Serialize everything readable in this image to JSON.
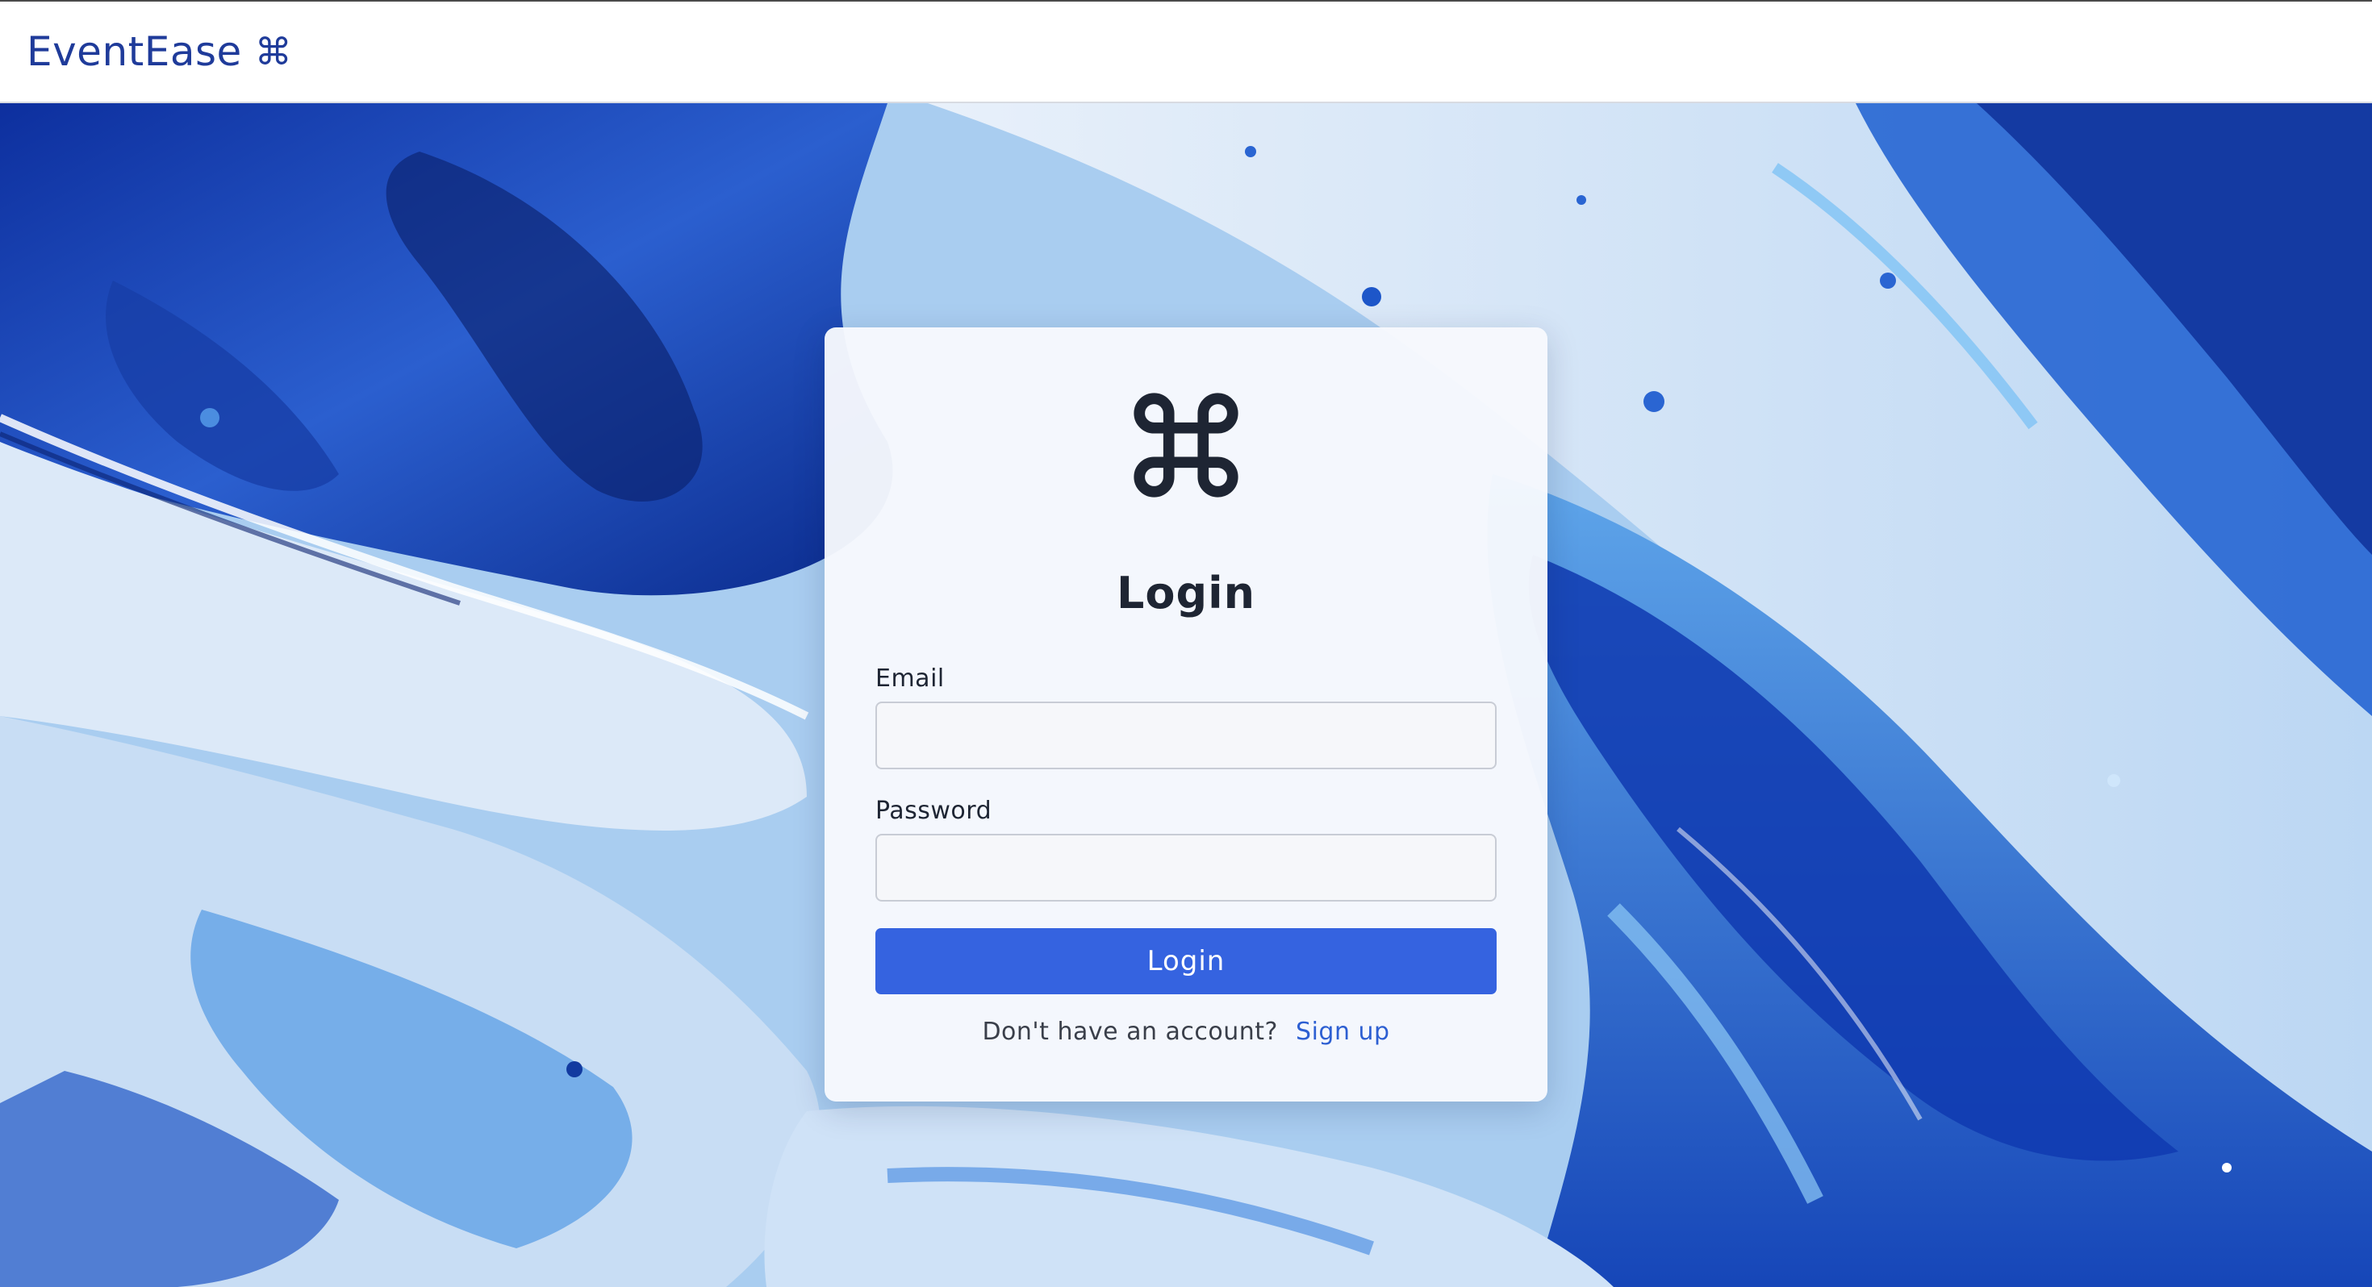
{
  "navbar": {
    "brand_name": "EventEase",
    "brand_icon": "⌘",
    "brand_icon_name": "command-icon"
  },
  "hero": {
    "background_theme": "blue fluid marble",
    "colors": {
      "deep_blue": "#0d2f9e",
      "mid_blue": "#2e6fd6",
      "light_blue": "#8fc3f1",
      "pale": "#e8f0fa"
    }
  },
  "login_card": {
    "logo_icon_name": "command-icon",
    "title": "Login",
    "email": {
      "label": "Email",
      "value": "",
      "placeholder": ""
    },
    "password": {
      "label": "Password",
      "value": "",
      "placeholder": ""
    },
    "submit_label": "Login",
    "signup_prompt": "Don't have an account?",
    "signup_link": "Sign up"
  },
  "colors": {
    "brand": "#1f3b9a",
    "primary_button": "#3563e0",
    "link": "#2d5fd2",
    "title_text": "#1e2533"
  }
}
